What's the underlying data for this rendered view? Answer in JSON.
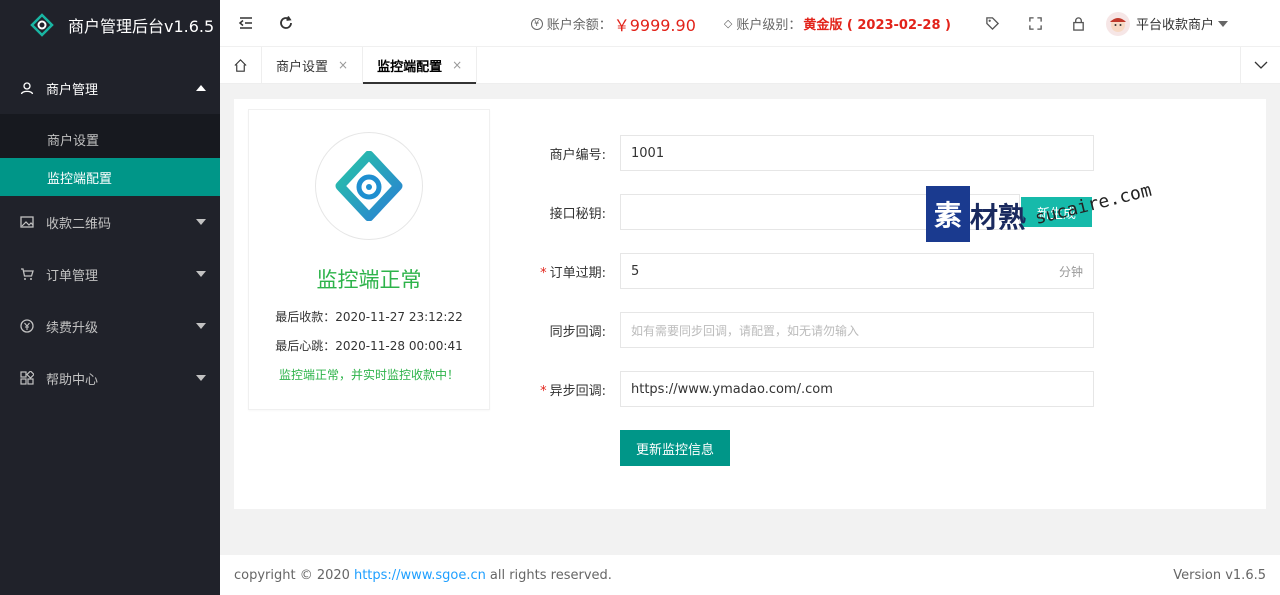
{
  "app": {
    "title": "商户管理后台v1.6.5"
  },
  "sidebar": {
    "items": [
      {
        "label": "商户管理",
        "icon": "user-icon",
        "open": true,
        "children": [
          {
            "label": "商户设置",
            "active": false
          },
          {
            "label": "监控端配置",
            "active": true
          }
        ]
      },
      {
        "label": "收款二维码",
        "icon": "image-icon"
      },
      {
        "label": "订单管理",
        "icon": "cart-icon"
      },
      {
        "label": "续费升级",
        "icon": "yen-icon"
      },
      {
        "label": "帮助中心",
        "icon": "apps-icon"
      }
    ]
  },
  "header": {
    "balance_label": "账户余额：",
    "balance_value": "￥9999.90",
    "level_label": "账户级别：",
    "level_value": "黄金版 ( 2023-02-28 )",
    "user_name": "平台收款商户"
  },
  "tabs": [
    {
      "label": "商户设置",
      "close": "×",
      "active": false
    },
    {
      "label": "监控端配置",
      "close": "×",
      "active": true
    }
  ],
  "status": {
    "title": "监控端正常",
    "last_payment": "最后收款：2020-11-27 23:12:22",
    "last_heartbeat": "最后心跳：2020-11-28 00:00:41",
    "message": "监控端正常，并实时监控收款中！"
  },
  "form": {
    "merchant_id": {
      "label": "商户编号:",
      "value": "1001"
    },
    "secret": {
      "label": "接口秘钥:",
      "value": "",
      "button": "新生成"
    },
    "expire": {
      "label": "订单过期:",
      "value": "5",
      "suffix": "分钟",
      "required": "*"
    },
    "sync_callback": {
      "label": "同步回调:",
      "value": "",
      "placeholder": "如有需要同步回调，请配置，如无请勿输入"
    },
    "async_callback": {
      "label": "异步回调:",
      "value": "https://www.ymadao.com/.com",
      "required": "*"
    },
    "submit_label": "更新监控信息"
  },
  "watermark": {
    "box": "素",
    "text": "材熟",
    "url": "sucaire.com"
  },
  "footer": {
    "prefix": "copyright © 2020",
    "link": "https://www.sgoe.cn",
    "suffix": "all rights reserved.",
    "version": "Version v1.6.5"
  },
  "colors": {
    "accent": "#009688",
    "sidebar": "#20222a",
    "danger": "#e2231a",
    "success": "#2db34a",
    "link": "#1e9fff"
  }
}
